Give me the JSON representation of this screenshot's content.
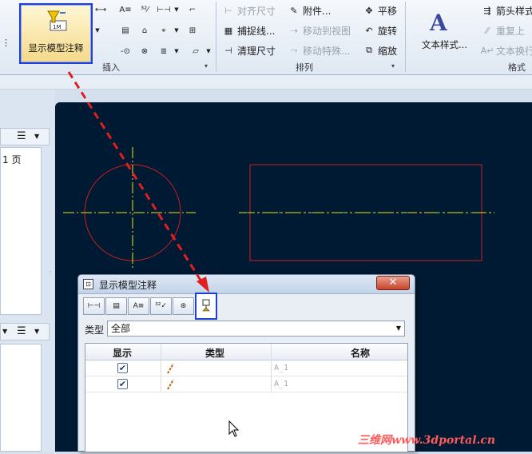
{
  "ribbon": {
    "show_annotations_label": "显示模型注释",
    "insert_group": "插入",
    "arrange_group": "排列",
    "format_group": "格式化",
    "arrange_tools": [
      {
        "label": "对齐尺寸",
        "enabled": false
      },
      {
        "label": "附件...",
        "enabled": true
      },
      {
        "label": "平移",
        "enabled": true
      },
      {
        "label": "捕捉线...",
        "enabled": true
      },
      {
        "label": "移动到视图",
        "enabled": false
      },
      {
        "label": "旋转",
        "enabled": true
      },
      {
        "label": "清理尺寸",
        "enabled": true
      },
      {
        "label": "移动特殊...",
        "enabled": false
      },
      {
        "label": "缩放",
        "enabled": true
      }
    ],
    "text_style_label": "文本样式...",
    "format_tools": [
      {
        "label": "箭头样式",
        "enabled": true
      },
      {
        "label": "重复上",
        "enabled": false
      },
      {
        "label": "文本换行",
        "enabled": false
      }
    ]
  },
  "left_panel": {
    "page_label": "1 页"
  },
  "dialog": {
    "title": "显示模型注释",
    "close_label": "✕",
    "tabs": [
      {
        "icon": "linear-dimension-icon"
      },
      {
        "icon": "gtol-icon"
      },
      {
        "icon": "note-icon"
      },
      {
        "icon": "surface-finish-icon"
      },
      {
        "icon": "datum-target-icon"
      },
      {
        "icon": "datum-feature-icon",
        "selected": true
      }
    ],
    "type_label": "类型",
    "type_value": "全部",
    "columns": {
      "show": "显示",
      "type": "类型",
      "name": "名称"
    },
    "rows": [
      {
        "checked": true,
        "name": "A_1"
      },
      {
        "checked": true,
        "name": "A_1"
      }
    ]
  },
  "watermark": "三维网www.3dportal.cn",
  "colors": {
    "canvas": "#001a33",
    "geometry": "#cc1f1f",
    "centerline": "#e6e61a",
    "highlight": "#1f3fd6",
    "arrow": "#e02020"
  }
}
